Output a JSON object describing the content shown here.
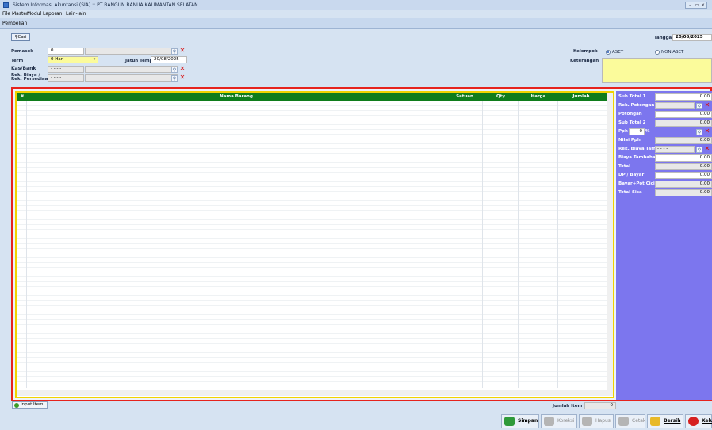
{
  "window": {
    "title": "Sistem Informasi Akuntansi (SIA) :: PT BANGUN BANUA KALIMANTAN SELATAN",
    "controls": "- ▫ X"
  },
  "menu": [
    "File",
    "Master",
    "Modul",
    "Laporan",
    "Lain-lain"
  ],
  "tab": {
    "label": "Pembelian"
  },
  "form": {
    "cari_label": "Cari",
    "tanggal_label": "Tanggal",
    "tanggal_value": "20/08/2025",
    "pemasok_label": "Pemasok",
    "pemasok_code": "0",
    "pemasok_name": "",
    "term_label": "Term",
    "term_value": "0 Hari",
    "jatuh_tempo_label": "Jatuh Temp",
    "jatuh_tempo_value": "20/08/2025",
    "kas_bank_label": "Kas/Bank",
    "kas_bank_value": "- - - -",
    "rek_biaya_label_1": "Rek. Biaya /",
    "rek_biaya_label_2": "Rek. Persediaan",
    "rek_biaya_value": "- - - -",
    "kelompok_label": "Kelompok",
    "kelompok_options": [
      "ASET",
      "NON ASET"
    ],
    "kelompok_selected": "ASET",
    "keterangan_label": "Keterangan",
    "keterangan_value": ""
  },
  "grid": {
    "columns": [
      "#",
      "Nama Barang",
      "Satuan",
      "Qty",
      "Harga",
      "Jumlah"
    ],
    "rows": []
  },
  "summary": {
    "sub_total_1": {
      "label": "Sub Total 1",
      "value": "0.00"
    },
    "rek_potongan": {
      "label": "Rek. Potongan",
      "value": "- - - -"
    },
    "potongan": {
      "label": "Potongan",
      "value": "0.00"
    },
    "sub_total_2": {
      "label": "Sub Total 2",
      "value": "0.00"
    },
    "pph": {
      "label": "Pph",
      "value": "0",
      "unit": "%"
    },
    "nilai_pph": {
      "label": "Nilai Pph",
      "value": "0.00"
    },
    "rek_biaya_tamb": {
      "label": "Rek. Biaya Tamb",
      "value": "- - - -"
    },
    "biaya_tambahan": {
      "label": "Biaya Tambahan",
      "value": "0.00"
    },
    "total": {
      "label": "Total",
      "value": "0.00"
    },
    "dp_bayar": {
      "label": "DP / Bayar",
      "value": "0.00"
    },
    "bayar_pot_cicil": {
      "label": "Bayar+Pot Cicil",
      "value": "0.00"
    },
    "total_sisa": {
      "label": "Total Sisa",
      "value": "0.00"
    }
  },
  "footer": {
    "input_item_label": "Input Item",
    "jumlah_item_label": "Jumlah Item",
    "jumlah_item_value": "0"
  },
  "actions": {
    "simpan": "Simpan",
    "koreksi": "Koreksi",
    "hapus": "Hapus",
    "cetak": "Cetak",
    "bersih": "Bersih",
    "keluar": "Keluar"
  },
  "colors": {
    "grid_header": "#0f7d1c",
    "frame": "#e6231d",
    "grid_border": "#f1d300",
    "summary_bg": "#7c76ee",
    "highlight_field": "#fbfb9b"
  }
}
